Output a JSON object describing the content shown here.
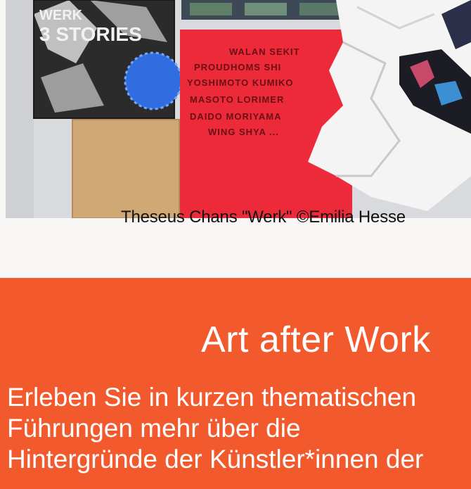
{
  "photo": {
    "caption": "Theseus Chans \"Werk\" ©Emilia Hesse",
    "poster_left_text": "WERK\n3 STORIES",
    "poster_red_lines": [
      "WALAN SEKIT",
      "PROUDHOMS SHI",
      "YOSHIMOTO KUMIKO",
      "MASOTO LORIMER",
      "DAIDO MORIYAMA",
      "WING SHYA ..."
    ]
  },
  "section": {
    "title": "Art after Work",
    "body": "Erleben Sie in kurzen thematischen\nFührungen mehr über die\nHintergründe der Künstler*innen der"
  }
}
